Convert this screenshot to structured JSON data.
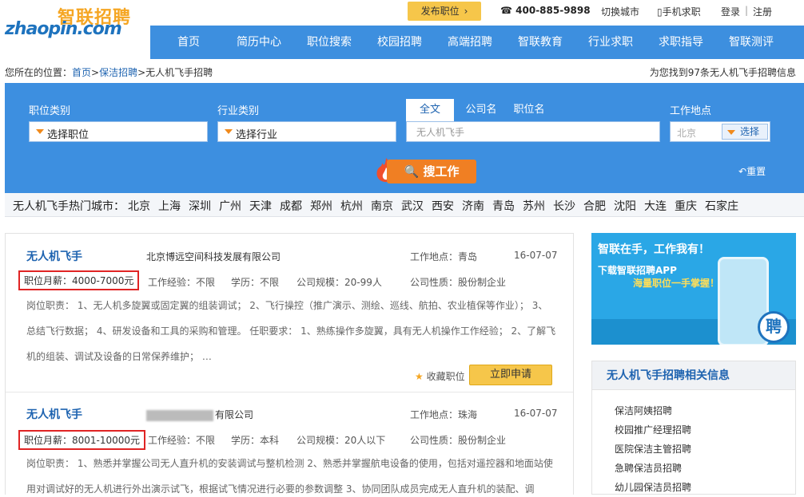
{
  "header": {
    "logo_cn": "智联招聘",
    "logo_en": "zhaopin.com",
    "post_job": "发布职位",
    "hotline": "400-885-9898",
    "switch_city": "切换城市",
    "mobile_job": "手机求职",
    "login": "登录",
    "separator": "|",
    "register": "注册"
  },
  "nav": [
    "首页",
    "简历中心",
    "职位搜索",
    "校园招聘",
    "高端招聘",
    "智联教育",
    "行业求职",
    "求职指导",
    "智联测评"
  ],
  "breadcrumb": {
    "prefix": "您所在的位置：",
    "home": "首页",
    "sep1": ">",
    "category": "保洁招聘",
    "sep2": ">",
    "current": "无人机飞手招聘"
  },
  "found_text": "为您找到97条无人机飞手招聘信息",
  "search": {
    "job_category_label": "职位类别",
    "job_category_value": "选择职位",
    "industry_label": "行业类别",
    "industry_value": "选择行业",
    "tabs": [
      "全文",
      "公司名",
      "职位名"
    ],
    "keyword": "无人机飞手",
    "location_label": "工作地点",
    "location_value": "北京",
    "location_button": "选择",
    "search_button": "搜工作",
    "reset": "重置"
  },
  "hot_cities": {
    "title": "无人机飞手热门城市：",
    "cities": [
      "北京",
      "上海",
      "深圳",
      "广州",
      "天津",
      "成都",
      "郑州",
      "杭州",
      "南京",
      "武汉",
      "西安",
      "济南",
      "青岛",
      "苏州",
      "长沙",
      "合肥",
      "沈阳",
      "大连",
      "重庆",
      "石家庄"
    ]
  },
  "jobs": [
    {
      "title": "无人机飞手",
      "company": "北京博远空间科技发展有限公司",
      "location": "工作地点：青岛",
      "date": "16-07-07",
      "salary": "职位月薪：4000-7000元",
      "experience": "工作经验：不限",
      "education": "学历：不限",
      "size": "公司规模：20-99人",
      "nature": "公司性质：股份制企业",
      "desc": "岗位职责： 1、无人机多旋翼或固定翼的组装调试； 2、飞行操控（推广演示、测绘、巡线、航拍、农业植保等作业）； 3、总结飞行数据； 4、研发设备和工具的采购和管理。 任职要求： 1、熟练操作多旋翼，具有无人机操作工作经验； 2、了解飞机的组装、调试及设备的日常保养维护； …",
      "fav": "收藏职位",
      "apply": "立即申请"
    },
    {
      "title": "无人机飞手",
      "company": "有限公司",
      "location": "工作地点：珠海",
      "date": "16-07-07",
      "salary": "职位月薪：8001-10000元",
      "experience": "工作经验：不限",
      "education": "学历：本科",
      "size": "公司规模：20人以下",
      "nature": "公司性质：股份制企业",
      "desc": "岗位职责： 1、熟悉并掌握公司无人直升机的安装调试与整机检测 2、熟悉并掌握航电设备的使用，包括对遥控器和地面站使用对调试好的无人机进行外出演示试飞，根据试飞情况进行必要的参数调整 3、协同团队成员完成无人直升机的装配、调"
    }
  ],
  "ad": {
    "line1": "智联在手，工作我有！",
    "line2": "下载智联招聘APP",
    "line3": "海量职位一手掌握！",
    "badge": "聘"
  },
  "related": {
    "title": "无人机飞手招聘相关信息",
    "items": [
      "保洁阿姨招聘",
      "校园推广经理招聘",
      "医院保洁主管招聘",
      "急聘保洁员招聘",
      "幼儿园保洁员招聘"
    ]
  },
  "colors": {
    "brand_blue": "#3d8fdf",
    "accent_orange": "#f07f23",
    "link_blue": "#1e63b0",
    "salary_box": "#e02424"
  }
}
